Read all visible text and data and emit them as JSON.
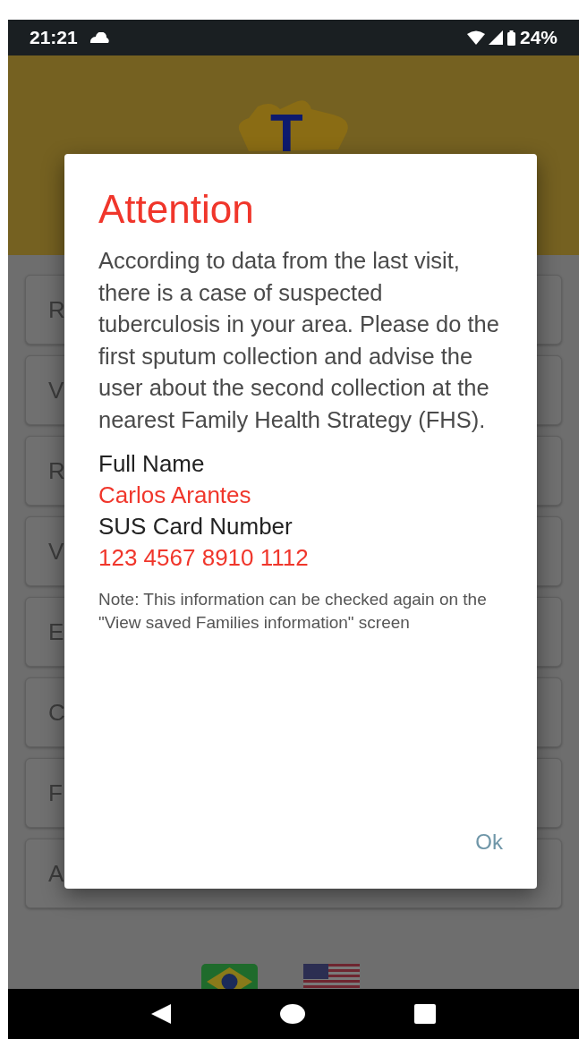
{
  "status_bar": {
    "time": "21:21",
    "battery": "24%"
  },
  "header": {
    "logo_letter": "T"
  },
  "menu_items": [
    {
      "label": "R"
    },
    {
      "label": "V"
    },
    {
      "label": "R"
    },
    {
      "label": "V"
    },
    {
      "label": "E"
    },
    {
      "label": "C"
    },
    {
      "label": "F"
    },
    {
      "label": "A"
    }
  ],
  "dialog": {
    "title": "Attention",
    "message": "According to data from the last visit, there is a case of suspected tuberculosis in your area. Please do the first sputum collection and advise the user about the second collection at the nearest Family Health Strategy (FHS).",
    "fields": [
      {
        "label": "Full Name",
        "value": "Carlos Arantes"
      },
      {
        "label": "SUS Card Number",
        "value": "123 4567 8910 1112"
      }
    ],
    "note": "Note: This information can be checked again on the \"View saved Families information\" screen",
    "button": "Ok"
  },
  "languages": [
    {
      "kind": "brazil"
    },
    {
      "kind": "usa"
    }
  ]
}
